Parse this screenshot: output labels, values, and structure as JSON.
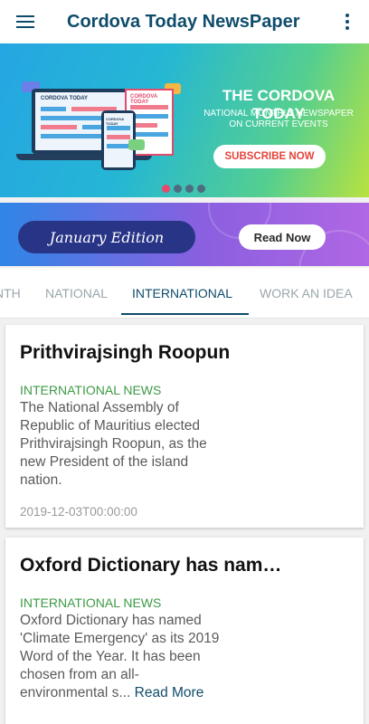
{
  "app": {
    "title": "Cordova Today NewsPaper"
  },
  "hero": {
    "mini_labels": [
      "CORDOVA TODAY",
      "CORDOVA TODAY",
      "CORDOVA TODAY"
    ],
    "title": "THE CORDOVA TODAY",
    "subtitle_line1": "NATIONAL MONTHLY NEWSPAPER",
    "subtitle_line2": "ON CURRENT EVENTS",
    "subscribe_label": "SUBSCRIBE NOW",
    "active_slide": 1,
    "slide_count": 4
  },
  "edition": {
    "title": "January Edition",
    "read_now_label": "Read Now"
  },
  "tabs": [
    {
      "label": "NTH",
      "active": false
    },
    {
      "label": "NATIONAL",
      "active": false
    },
    {
      "label": "INTERNATIONAL",
      "active": true
    },
    {
      "label": "WORK AN IDEA",
      "active": false
    }
  ],
  "articles": [
    {
      "title": "Prithvirajsingh Roopun",
      "category": "INTERNATIONAL NEWS",
      "body": "The National Assembly of Republic of Mauritius elected Prithvirajsingh Roopun, as the new President of the island nation.",
      "date": "2019-12-03T00:00:00"
    },
    {
      "title": "Oxford Dictionary has named 'Climate Emergency'",
      "category": "INTERNATIONAL NEWS",
      "body": "Oxford Dictionary has named 'Climate Emergency' as its 2019 Word of the Year. It has been chosen from an all-environmental s...",
      "read_more": "Read More"
    }
  ],
  "colors": {
    "primary": "#0f4c6b",
    "category_green": "#3d9b45",
    "slide_active": "#e9486b",
    "subscribe_red": "#e4443a"
  },
  "icons": {
    "menu": "hamburger-icon",
    "more": "more-vertical-icon"
  }
}
